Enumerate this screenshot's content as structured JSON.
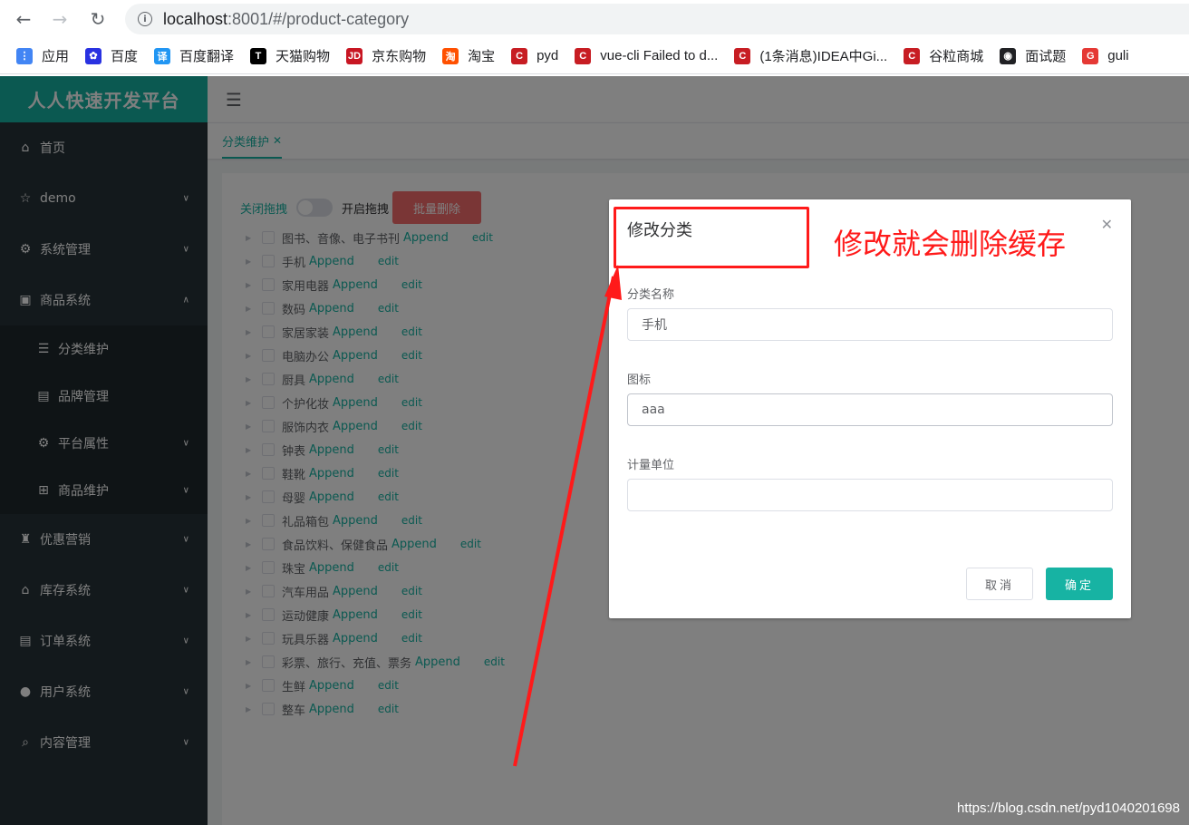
{
  "browser": {
    "url_host": "localhost",
    "url_rest": ":8001/#/product-category",
    "bookmarks": [
      {
        "label": "应用",
        "color": "#4285f4",
        "glyph": "⋮"
      },
      {
        "label": "百度",
        "color": "#2932e1",
        "glyph": "✿"
      },
      {
        "label": "百度翻译",
        "color": "#2196f3",
        "glyph": "译"
      },
      {
        "label": "天猫购物",
        "color": "#000000",
        "glyph": "T"
      },
      {
        "label": "京东购物",
        "color": "#c81623",
        "glyph": "JD"
      },
      {
        "label": "淘宝",
        "color": "#ff5000",
        "glyph": "淘"
      },
      {
        "label": "pyd",
        "color": "#c71d23",
        "glyph": "C"
      },
      {
        "label": "vue-cli Failed to d...",
        "color": "#c71d23",
        "glyph": "C"
      },
      {
        "label": "(1条消息)IDEA中Gi...",
        "color": "#c71d23",
        "glyph": "C"
      },
      {
        "label": "谷粒商城",
        "color": "#c71d23",
        "glyph": "C"
      },
      {
        "label": "面试题",
        "color": "#202124",
        "glyph": "◉"
      },
      {
        "label": "guli",
        "color": "#e53935",
        "glyph": "G"
      }
    ]
  },
  "app": {
    "brand": "人人快速开发平台",
    "menu": [
      {
        "label": "首页",
        "icon": "home-icon",
        "glyph": "⌂",
        "arrow": ""
      },
      {
        "label": "demo",
        "icon": "star-icon",
        "glyph": "☆",
        "arrow": "∨"
      },
      {
        "label": "系统管理",
        "icon": "gear-icon",
        "glyph": "⚙",
        "arrow": "∨"
      },
      {
        "label": "商品系统",
        "icon": "box-icon",
        "glyph": "▣",
        "arrow": "∧"
      }
    ],
    "submenu": [
      {
        "label": "分类维护",
        "icon": "list-icon",
        "glyph": "☰",
        "arrow": ""
      },
      {
        "label": "品牌管理",
        "icon": "table-icon",
        "glyph": "▤",
        "arrow": ""
      },
      {
        "label": "平台属性",
        "icon": "gear-icon",
        "glyph": "⚙",
        "arrow": "∨"
      },
      {
        "label": "商品维护",
        "icon": "grid-icon",
        "glyph": "⊞",
        "arrow": "∨"
      }
    ],
    "menu2": [
      {
        "label": "优惠营销",
        "icon": "trophy-icon",
        "glyph": "♜",
        "arrow": "∨"
      },
      {
        "label": "库存系统",
        "icon": "home-icon",
        "glyph": "⌂",
        "arrow": "∨"
      },
      {
        "label": "订单系统",
        "icon": "document-icon",
        "glyph": "▤",
        "arrow": "∨"
      },
      {
        "label": "用户系统",
        "icon": "user-icon",
        "glyph": "●",
        "arrow": "∨"
      },
      {
        "label": "内容管理",
        "icon": "search-icon",
        "glyph": "⌕",
        "arrow": "∨"
      }
    ],
    "hamburger": "☰",
    "tab": {
      "label": "分类维护",
      "close": "✕"
    },
    "toolbar": {
      "drag_off": "关闭拖拽",
      "drag_on": "开启拖拽",
      "batch_delete": "批量删除"
    },
    "tree": [
      "图书、音像、电子书刊",
      "手机",
      "家用电器",
      "数码",
      "家居家装",
      "电脑办公",
      "厨具",
      "个护化妆",
      "服饰内衣",
      "钟表",
      "鞋靴",
      "母婴",
      "礼品箱包",
      "食品饮料、保健食品",
      "珠宝",
      "汽车用品",
      "运动健康",
      "玩具乐器",
      "彩票、旅行、充值、票务",
      "生鲜",
      "整车"
    ],
    "tree_append": "Append",
    "tree_edit": "edit"
  },
  "dialog": {
    "title": "修改分类",
    "close": "✕",
    "fields": [
      {
        "label": "分类名称",
        "value": "手机"
      },
      {
        "label": "图标",
        "value": "aaa"
      },
      {
        "label": "计量单位",
        "value": ""
      }
    ],
    "cancel": "取消",
    "confirm": "确定"
  },
  "annotation": {
    "text": "修改就会删除缓存",
    "color": "#ff1a1a"
  },
  "watermark": "https://blog.csdn.net/pyd1040201698"
}
